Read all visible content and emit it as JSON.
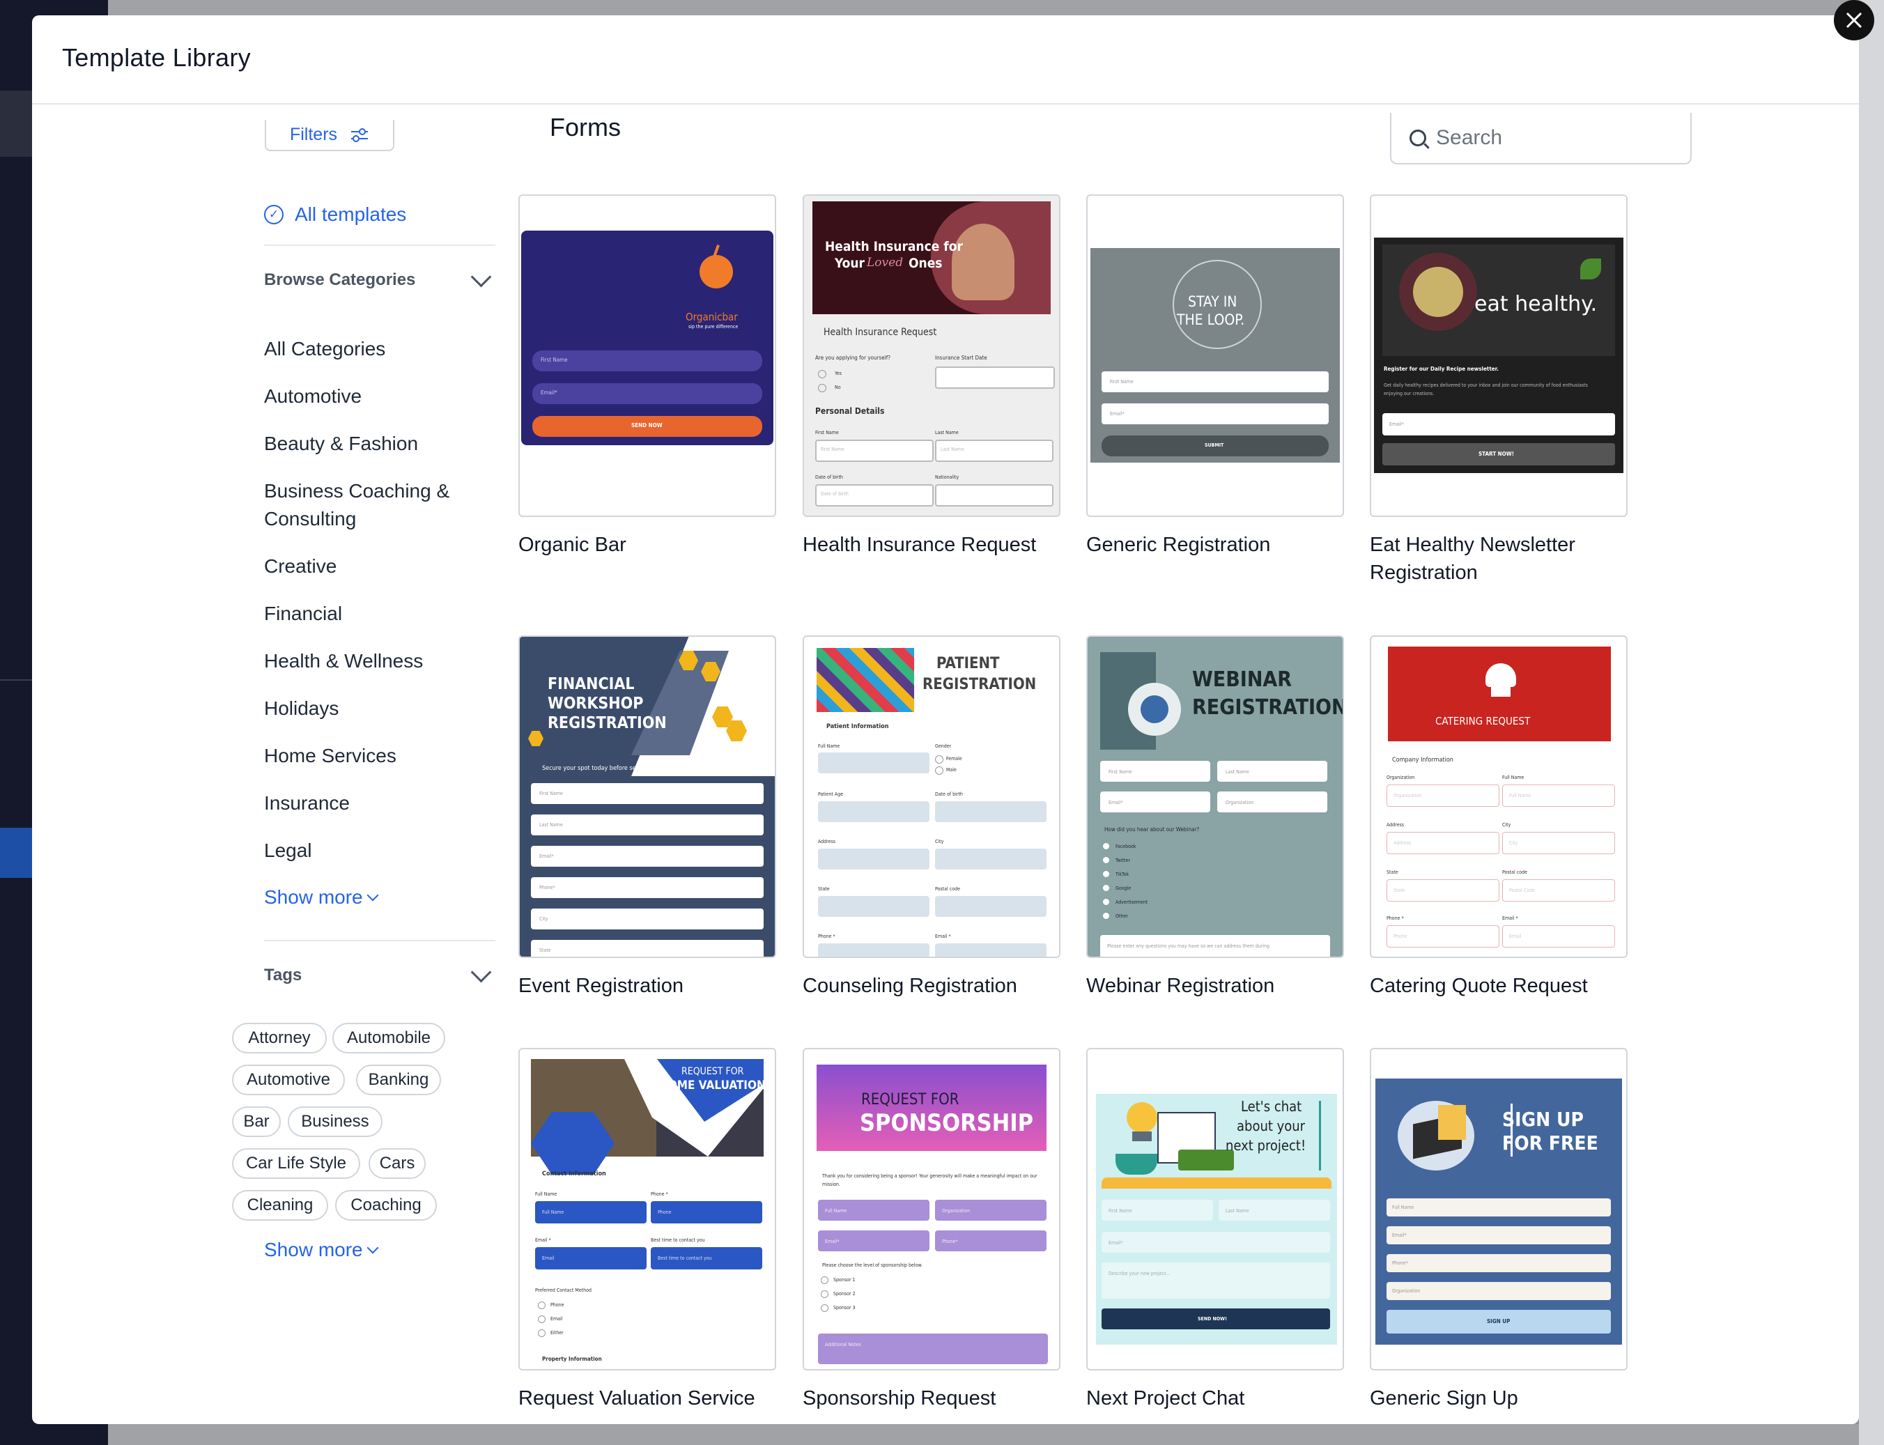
{
  "modal": {
    "title": "Template Library",
    "close_icon": "close-icon"
  },
  "sidebar": {
    "filters_label": "Filters",
    "all_templates_label": "All templates",
    "categories_heading": "Browse Categories",
    "categories": [
      "All Categories",
      "Automotive",
      "Beauty & Fashion",
      "Business Coaching & Consulting",
      "Creative",
      "Financial",
      "Health & Wellness",
      "Holidays",
      "Home Services",
      "Insurance",
      "Legal"
    ],
    "categories_show_more": "Show more",
    "tags_heading": "Tags",
    "tags": [
      "Attorney",
      "Automobile",
      "Automotive",
      "Banking",
      "Bar",
      "Business",
      "Car Life Style",
      "Cars",
      "Cleaning",
      "Coaching"
    ],
    "tags_show_more": "Show more"
  },
  "main": {
    "section_title": "Forms",
    "search_placeholder": "Search",
    "templates": [
      {
        "name": "Organic Bar"
      },
      {
        "name": "Health Insurance Request"
      },
      {
        "name": "Generic Registration"
      },
      {
        "name": "Eat Healthy Newsletter Registration"
      },
      {
        "name": "Event Registration"
      },
      {
        "name": "Counseling Registration"
      },
      {
        "name": "Webinar Registration"
      },
      {
        "name": "Catering Quote Request"
      },
      {
        "name": "Request Valuation Service"
      },
      {
        "name": "Sponsorship Request"
      },
      {
        "name": "Next Project Chat"
      },
      {
        "name": "Generic Sign Up"
      }
    ]
  },
  "thumbs": {
    "organic_bar": {
      "brand": "Organicbar",
      "tagline": "sip the pure difference",
      "f1": "First Name",
      "f2": "Email*",
      "button": "SEND NOW"
    },
    "health": {
      "line1": "Health Insurance for",
      "line2a": "Your",
      "line2b": "Loved",
      "line2c": "Ones",
      "form_title": "Health Insurance Request",
      "q1": "Are you applying for yourself?",
      "q2": "Insurance Start Date",
      "yes": "Yes",
      "no": "No",
      "section": "Personal Details",
      "fn": "First Name",
      "ln": "Last Name",
      "fnp": "First Name",
      "lnp": "Last Name",
      "dob": "Date of birth",
      "nat": "Nationality",
      "dobp": "Date of birth"
    },
    "generic_reg": {
      "line1": "STAY IN",
      "line2": "THE LOOP.",
      "f1": "First Name",
      "f2": "Email*",
      "button": "SUBMIT"
    },
    "eat_healthy": {
      "headline": "eat healthy.",
      "subtitle": "Register for our Daily Recipe newsletter.",
      "body": "Get daily healthy recipes delivered to your inbox and join our community of food enthusiasts enjoying our creations.",
      "f1": "Email*",
      "button": "START NOW!"
    },
    "financial": {
      "line1": "FINANCIAL",
      "line2": "WORKSHOP",
      "line3": "REGISTRATION",
      "sub": "Secure your spot today before seats fill up!",
      "f1": "First Name",
      "f2": "Last Name",
      "f3": "Email*",
      "f4": "Phone*",
      "f5": "City",
      "f6": "State"
    },
    "patient": {
      "line1": "PATIENT",
      "line2": "REGISTRATION",
      "section": "Patient Information",
      "l1": "Full Name",
      "l2": "Gender",
      "female": "Female",
      "male": "Male",
      "l3": "Patient Age",
      "l4": "Date of birth",
      "l5": "Address",
      "l6": "City",
      "l7": "State",
      "l8": "Postal code",
      "l9": "Phone *",
      "l10": "Email *"
    },
    "webinar": {
      "line1": "WEBINAR",
      "line2": "REGISTRATION",
      "f1": "First Name",
      "f2": "Last Name",
      "f3": "Email*",
      "f4": "Organization",
      "q": "How did you hear about our Webinar?",
      "o1": "Facebook",
      "o2": "Twitter",
      "o3": "TikTok",
      "o4": "Google",
      "o5": "Advertisement",
      "o6": "Other",
      "note": "Please enter any questions you may have so we can address them during"
    },
    "catering": {
      "title": "CATERING REQUEST",
      "section": "Company Information",
      "l1": "Organization",
      "l2": "Full Name",
      "p1": "Organization",
      "p2": "Full Name",
      "l3": "Address",
      "l4": "City",
      "p3": "Address",
      "p4": "City",
      "l5": "State",
      "l6": "Postal code",
      "p5": "State",
      "p6": "Postal Code",
      "l7": "Phone *",
      "l8": "Email *",
      "p7": "Phone",
      "p8": "Email"
    },
    "valuation": {
      "line1": "REQUEST FOR",
      "line2": "HOME VALUATION",
      "section": "Contact Information",
      "l1": "Full Name",
      "l2": "Phone *",
      "p1": "Full Name",
      "p2": "Phone",
      "l3": "Email *",
      "l4": "Best time to contact you",
      "p3": "Email",
      "p4": "Best time to contact you",
      "pref": "Preferred Contact Method",
      "o1": "Phone",
      "o2": "Email",
      "o3": "Either",
      "section2": "Property Information"
    },
    "sponsorship": {
      "line1": "REQUEST FOR",
      "line2": "SPONSORSHIP",
      "body": "Thank you for considering being a sponsor! Your generosity will make a meaningful impact on our mission.",
      "f1": "Full Name",
      "f2": "Organization",
      "f3": "Email*",
      "f4": "Phone*",
      "q": "Please choose the level of sponsorship below.",
      "o1": "Sponsor 1",
      "o2": "Sponsor 2",
      "o3": "Sponsor 3",
      "notes": "Additional Notes"
    },
    "chat": {
      "line1": "Let's chat",
      "line2": "about your",
      "line3": "next project!",
      "f1": "First Name",
      "f2": "Last Name",
      "f3": "Email*",
      "f4": "Describe your new project...",
      "button": "SEND NOW!"
    },
    "signup": {
      "line1": "SIGN UP",
      "line2": "FOR FREE",
      "f1": "Full Name",
      "f2": "Email*",
      "f3": "Phone*",
      "f4": "Organization",
      "button": "SIGN UP"
    }
  },
  "colors": {
    "accent": "#2563eb",
    "overlay": "#8e9095"
  }
}
